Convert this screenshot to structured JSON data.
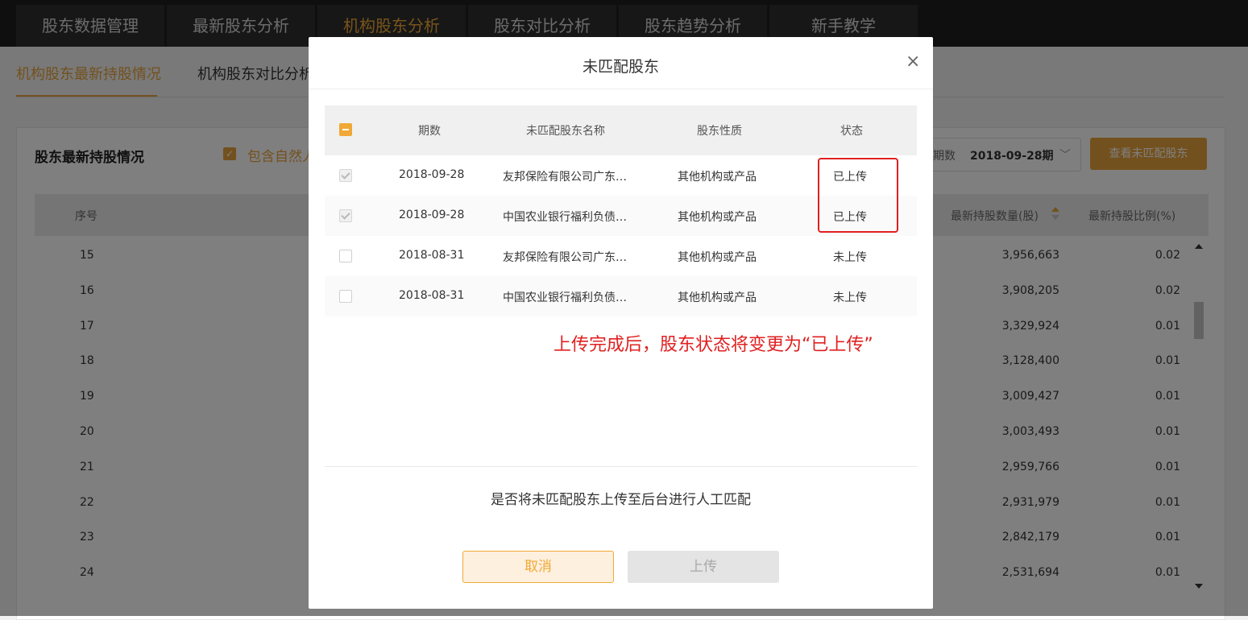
{
  "topnav": {
    "tabs": [
      "股东数据管理",
      "最新股东分析",
      "机构股东分析",
      "股东对比分析",
      "股东趋势分析",
      "新手教学"
    ],
    "active_index": 2
  },
  "subnav": {
    "items": [
      "机构股东最新持股情况",
      "机构股东对比分析"
    ],
    "active_index": 0
  },
  "panel": {
    "title": "股东最新持股情况",
    "include_label": "包含自然人",
    "period_label": "期数",
    "period_value": "2018-09-28期",
    "view_button": "查看未匹配股东",
    "columns": {
      "index": "序号",
      "qty": "最新持股数量(股)",
      "pct": "最新持股比例(%)"
    },
    "rows": [
      {
        "idx": "15",
        "qty": "3,956,663",
        "pct": "0.02"
      },
      {
        "idx": "16",
        "qty": "3,908,205",
        "pct": "0.02"
      },
      {
        "idx": "17",
        "qty": "3,329,924",
        "pct": "0.01"
      },
      {
        "idx": "18",
        "qty": "3,128,400",
        "pct": "0.01"
      },
      {
        "idx": "19",
        "qty": "3,009,427",
        "pct": "0.01"
      },
      {
        "idx": "20",
        "qty": "3,003,493",
        "pct": "0.01"
      },
      {
        "idx": "21",
        "qty": "2,959,766",
        "pct": "0.01"
      },
      {
        "idx": "22",
        "qty": "2,931,979",
        "pct": "0.01"
      },
      {
        "idx": "23",
        "qty": "2,842,179",
        "pct": "0.01"
      },
      {
        "idx": "24",
        "qty": "2,531,694",
        "pct": "0.01"
      }
    ]
  },
  "modal": {
    "title": "未匹配股东",
    "close_icon": "×",
    "columns": {
      "period": "期数",
      "name": "未匹配股东名称",
      "type": "股东性质",
      "status": "状态"
    },
    "rows": [
      {
        "period": "2018-09-28",
        "name": "友邦保险有限公司广东…",
        "type": "其他机构或产品",
        "status": "已上传",
        "checked": true
      },
      {
        "period": "2018-09-28",
        "name": "中国农业银行福利负债…",
        "type": "其他机构或产品",
        "status": "已上传",
        "checked": true
      },
      {
        "period": "2018-08-31",
        "name": "友邦保险有限公司广东…",
        "type": "其他机构或产品",
        "status": "未上传",
        "checked": false
      },
      {
        "period": "2018-08-31",
        "name": "中国农业银行福利负债…",
        "type": "其他机构或产品",
        "status": "未上传",
        "checked": false
      }
    ],
    "annotation": "上传完成后，股东状态将变更为“已上传”",
    "question": "是否将未匹配股东上传至后台进行人工匹配",
    "cancel_label": "取消",
    "upload_label": "上传"
  },
  "colors": {
    "accent": "#e6a23c",
    "annotation": "#e02020"
  }
}
